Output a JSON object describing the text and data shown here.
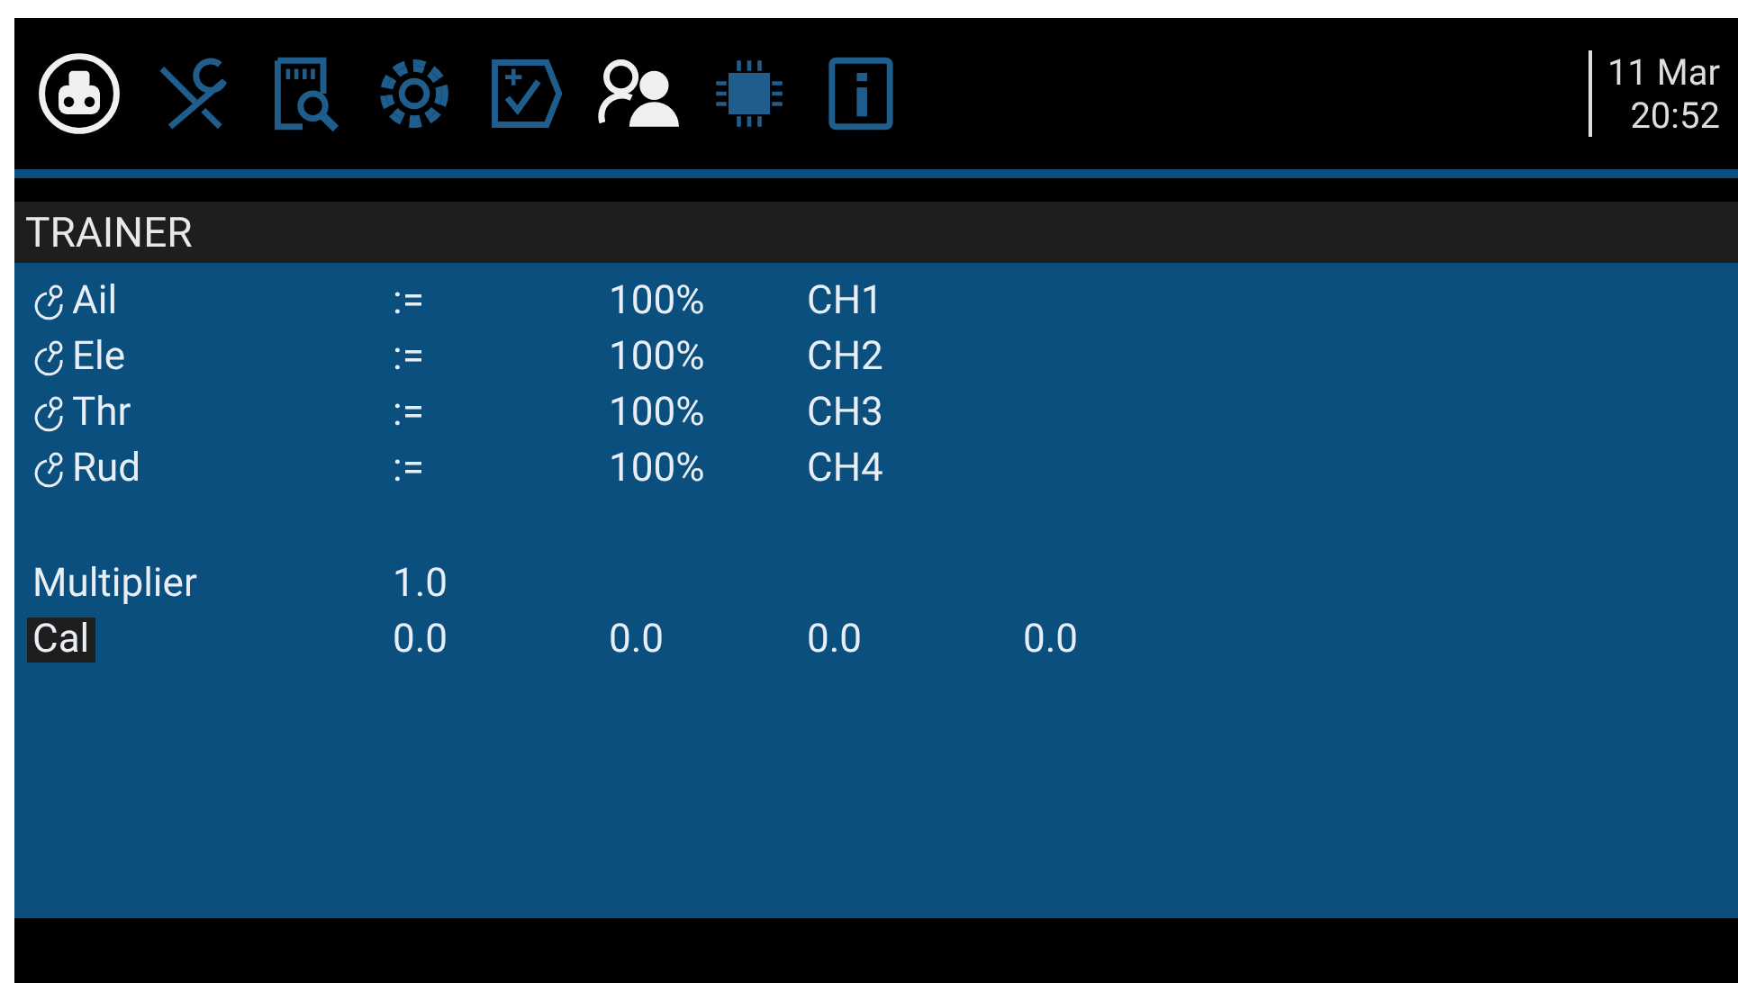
{
  "tabs": [
    {
      "kind": "radio",
      "selected": true
    },
    {
      "kind": "tools",
      "selected": false
    },
    {
      "kind": "sdcard",
      "selected": false
    },
    {
      "kind": "gear",
      "selected": false
    },
    {
      "kind": "checklist",
      "selected": false
    },
    {
      "kind": "trainer",
      "selected": true
    },
    {
      "kind": "chip",
      "selected": false
    },
    {
      "kind": "info",
      "selected": false
    }
  ],
  "date": "11 Mar",
  "time": "20:52",
  "title": "TRAINER",
  "channels": [
    {
      "name": "Ail",
      "op": ":=",
      "weight": "100%",
      "output": "CH1"
    },
    {
      "name": "Ele",
      "op": ":=",
      "weight": "100%",
      "output": "CH2"
    },
    {
      "name": "Thr",
      "op": ":=",
      "weight": "100%",
      "output": "CH3"
    },
    {
      "name": "Rud",
      "op": ":=",
      "weight": "100%",
      "output": "CH4"
    }
  ],
  "multiplier": {
    "label": "Multiplier",
    "value": "1.0"
  },
  "calibration": {
    "label": "Cal",
    "selected": true,
    "values": [
      "0.0",
      "0.0",
      "0.0",
      "0.0"
    ]
  }
}
